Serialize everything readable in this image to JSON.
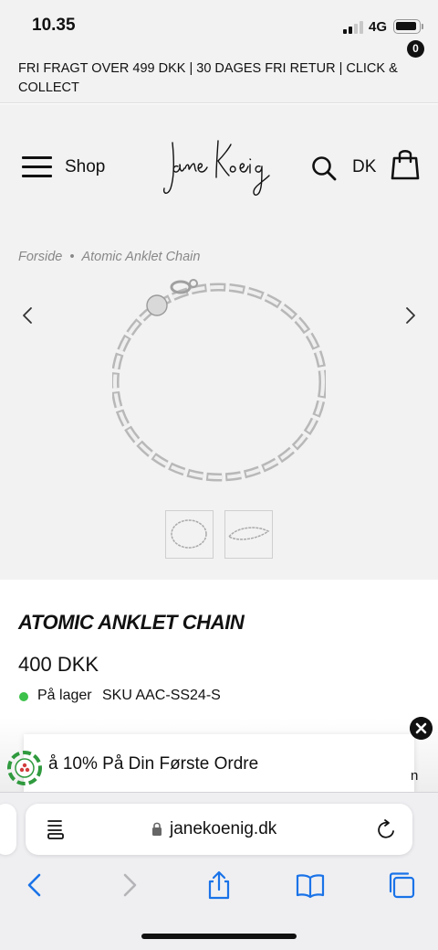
{
  "status_bar": {
    "time": "10.35",
    "network": "4G"
  },
  "promo_banner": {
    "text": "FRI FRAGT OVER 499 DKK  |  30 DAGES FRI RETUR  |  CLICK & COLLECT"
  },
  "header": {
    "shop_label": "Shop",
    "logo_text": "Jane Koenig",
    "language": "DK",
    "cart_count": "0"
  },
  "breadcrumb": {
    "home": "Forside",
    "separator": "•",
    "current": "Atomic Anklet Chain"
  },
  "product": {
    "title": "ATOMIC ANKLET CHAIN",
    "price": "400 DKK",
    "stock": "På lager",
    "sku": "SKU AAC-SS24-S"
  },
  "popup": {
    "text": "å 10% På Din Første Ordre",
    "trailing_text": "n"
  },
  "browser": {
    "url": "janekoenig.dk"
  },
  "colors": {
    "accent_green": "#3cc14a",
    "header_bg": "#f2f2f2",
    "safari_blue": "#1a73e8"
  },
  "icons": [
    "menu-icon",
    "search-icon",
    "shopping-bag-icon",
    "chevron-left-icon",
    "chevron-right-icon",
    "close-icon",
    "reader-icon",
    "lock-icon",
    "reload-icon",
    "share-icon",
    "bookmarks-icon",
    "tabs-icon"
  ]
}
